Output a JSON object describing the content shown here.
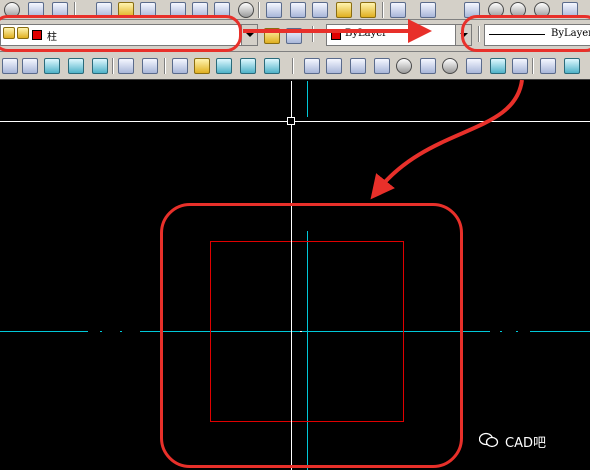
{
  "layer_toolbar": {
    "layer_name": "柱",
    "layer_color": "#e00000"
  },
  "properties_toolbar": {
    "color_value": "ByLayer",
    "color_swatch": "#e00000",
    "linetype_value": "ByLayer"
  },
  "canvas": {
    "background": "#000000",
    "crosshair_color": "#ffffff",
    "axis_color": "#00c8d8",
    "column_outline_color": "#e00000"
  },
  "annotation": {
    "color": "#e8302a"
  },
  "watermark": {
    "text": "CAD吧",
    "icon": "wechat-icon"
  }
}
